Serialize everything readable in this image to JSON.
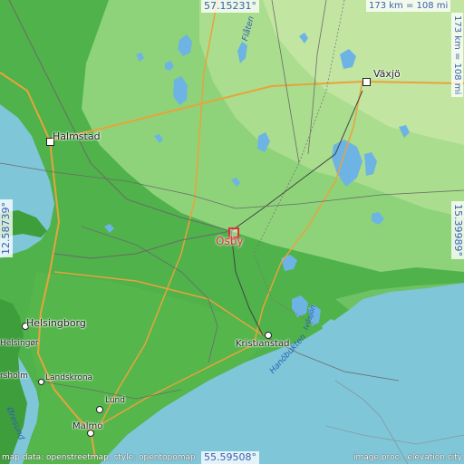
{
  "coords": {
    "top": "57.15231°",
    "bottom": "55.59508°",
    "left": "12.58739°",
    "right": "15.39989°"
  },
  "scale": {
    "horizontal": "173 km = 108 mi",
    "vertical": "173 km = 108 mi"
  },
  "target": {
    "name": "Osby"
  },
  "cities": {
    "vaxjo": "Växjö",
    "halmstad": "Halmstad",
    "helsingborg": "Helsingborg",
    "kristianstad": "Kristianstad",
    "landskrona": "Landskrona",
    "lund": "Lund",
    "malmo": "Malmö",
    "helsingor": "Helsingør",
    "hersholm": "rsholm"
  },
  "water": {
    "hanobukten": "Hanöbukten",
    "oresund": "Øresund",
    "flaten": "Flåten",
    "ivosjon": "Ivösjön"
  },
  "credits": {
    "left": "map data: openstreetmap, style: opentopomap",
    "right": "image proc.: elevation.city"
  },
  "colors": {
    "sea": "#7fc6d8",
    "lowland": "#4fb24a",
    "upland": "#9fd88a",
    "highland": "#c9e9a6",
    "lake": "#6db3e4",
    "target": "#e03030",
    "coord_text": "#3a5fb0"
  }
}
